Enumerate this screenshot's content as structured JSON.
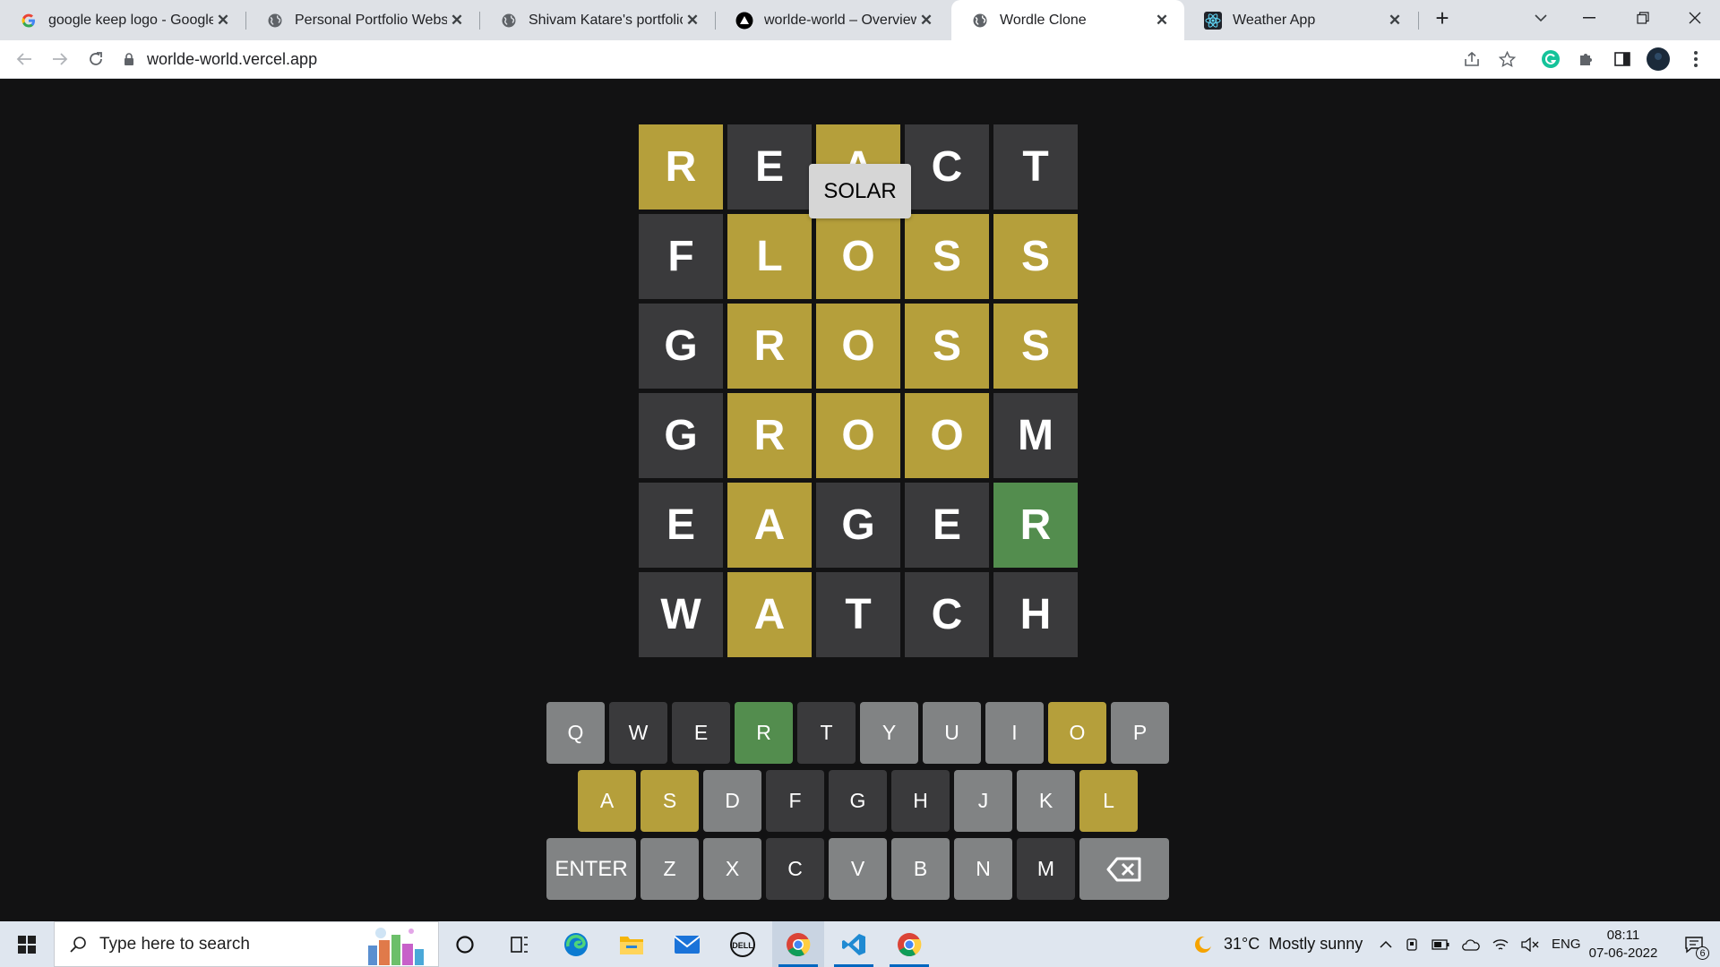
{
  "browser": {
    "tabs": [
      {
        "title": "google keep logo - Google",
        "favicon": "google-g-icon",
        "active": false
      },
      {
        "title": "Personal Portfolio Website",
        "favicon": "globe-icon",
        "active": false
      },
      {
        "title": "Shivam Katare's portfolio",
        "favicon": "globe-icon",
        "active": false
      },
      {
        "title": "worlde-world – Overview –",
        "favicon": "vercel-icon",
        "active": false
      },
      {
        "title": "Wordle Clone",
        "favicon": "globe-icon",
        "active": true
      },
      {
        "title": "Weather App",
        "favicon": "react-icon",
        "active": false
      }
    ],
    "close_glyph": "✕",
    "new_tab_glyph": "+",
    "url": "worlde-world.vercel.app"
  },
  "game": {
    "toast": "SOLAR",
    "board": [
      [
        {
          "letter": "R",
          "state": "present"
        },
        {
          "letter": "E",
          "state": "absent"
        },
        {
          "letter": "A",
          "state": "present"
        },
        {
          "letter": "C",
          "state": "absent"
        },
        {
          "letter": "T",
          "state": "absent"
        }
      ],
      [
        {
          "letter": "F",
          "state": "absent"
        },
        {
          "letter": "L",
          "state": "present"
        },
        {
          "letter": "O",
          "state": "present"
        },
        {
          "letter": "S",
          "state": "present"
        },
        {
          "letter": "S",
          "state": "present"
        }
      ],
      [
        {
          "letter": "G",
          "state": "absent"
        },
        {
          "letter": "R",
          "state": "present"
        },
        {
          "letter": "O",
          "state": "present"
        },
        {
          "letter": "S",
          "state": "present"
        },
        {
          "letter": "S",
          "state": "present"
        }
      ],
      [
        {
          "letter": "G",
          "state": "absent"
        },
        {
          "letter": "R",
          "state": "present"
        },
        {
          "letter": "O",
          "state": "present"
        },
        {
          "letter": "O",
          "state": "present"
        },
        {
          "letter": "M",
          "state": "absent"
        }
      ],
      [
        {
          "letter": "E",
          "state": "absent"
        },
        {
          "letter": "A",
          "state": "present"
        },
        {
          "letter": "G",
          "state": "absent"
        },
        {
          "letter": "E",
          "state": "absent"
        },
        {
          "letter": "R",
          "state": "correct"
        }
      ],
      [
        {
          "letter": "W",
          "state": "absent"
        },
        {
          "letter": "A",
          "state": "present"
        },
        {
          "letter": "T",
          "state": "absent"
        },
        {
          "letter": "C",
          "state": "absent"
        },
        {
          "letter": "H",
          "state": "absent"
        }
      ]
    ],
    "keyboard": [
      [
        {
          "label": "Q",
          "state": "unused"
        },
        {
          "label": "W",
          "state": "absent"
        },
        {
          "label": "E",
          "state": "absent"
        },
        {
          "label": "R",
          "state": "correct"
        },
        {
          "label": "T",
          "state": "absent"
        },
        {
          "label": "Y",
          "state": "unused"
        },
        {
          "label": "U",
          "state": "unused"
        },
        {
          "label": "I",
          "state": "unused"
        },
        {
          "label": "O",
          "state": "present"
        },
        {
          "label": "P",
          "state": "unused"
        }
      ],
      [
        {
          "label": "A",
          "state": "present"
        },
        {
          "label": "S",
          "state": "present"
        },
        {
          "label": "D",
          "state": "unused"
        },
        {
          "label": "F",
          "state": "absent"
        },
        {
          "label": "G",
          "state": "absent"
        },
        {
          "label": "H",
          "state": "absent"
        },
        {
          "label": "J",
          "state": "unused"
        },
        {
          "label": "K",
          "state": "unused"
        },
        {
          "label": "L",
          "state": "present"
        }
      ],
      [
        {
          "label": "ENTER",
          "state": "unused",
          "wide": true
        },
        {
          "label": "Z",
          "state": "unused"
        },
        {
          "label": "X",
          "state": "unused"
        },
        {
          "label": "C",
          "state": "absent"
        },
        {
          "label": "V",
          "state": "unused"
        },
        {
          "label": "B",
          "state": "unused"
        },
        {
          "label": "N",
          "state": "unused"
        },
        {
          "label": "M",
          "state": "absent"
        },
        {
          "label": "",
          "state": "unused",
          "wide": true,
          "icon": "backspace-icon"
        }
      ]
    ],
    "colors": {
      "absent": "#3a3a3c",
      "present": "#b59f3b",
      "correct": "#538d4e",
      "unused": "#818384",
      "background": "#121213"
    }
  },
  "taskbar": {
    "search_placeholder": "Type here to search",
    "apps": [
      "cortana-icon",
      "task-view-icon",
      "edge-icon",
      "file-explorer-icon",
      "mail-icon",
      "dell-icon",
      "chrome-icon",
      "vscode-icon",
      "chrome-icon"
    ],
    "weather": "31°C  Mostly sunny",
    "language": "ENG",
    "time": "08:11",
    "date": "07-06-2022",
    "notification_count": "6"
  }
}
